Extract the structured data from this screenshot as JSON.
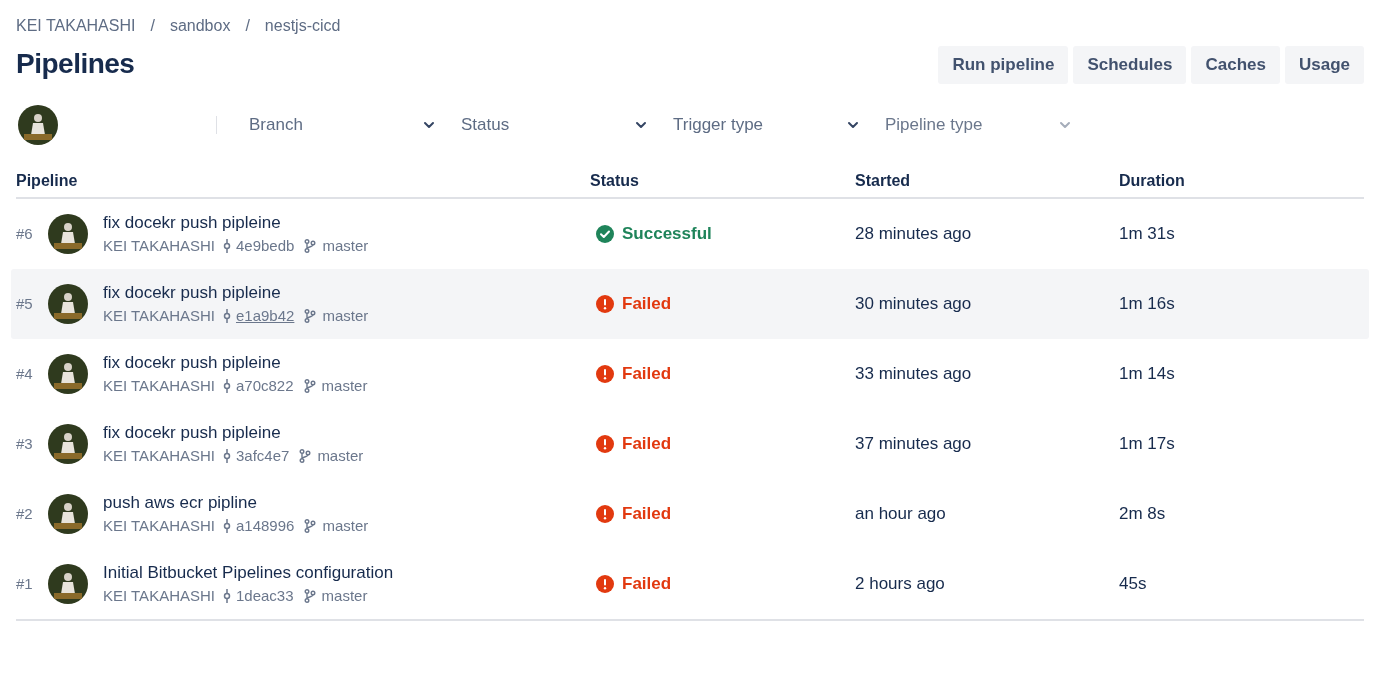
{
  "breadcrumbs": [
    "KEI TAKAHASHI",
    "sandbox",
    "nestjs-cicd"
  ],
  "breadcrumb_separators": [
    "/",
    "/"
  ],
  "title": "Pipelines",
  "actions": [
    "Run pipeline",
    "Schedules",
    "Caches",
    "Usage"
  ],
  "filters": [
    {
      "label": "Branch",
      "disabled": false
    },
    {
      "label": "Status",
      "disabled": false
    },
    {
      "label": "Trigger type",
      "disabled": false
    },
    {
      "label": "Pipeline type",
      "disabled": true
    }
  ],
  "table": {
    "columns": [
      "Pipeline",
      "Status",
      "Started",
      "Duration"
    ],
    "rows": [
      {
        "number": "#6",
        "message": "fix docekr push pipleine",
        "author": "KEI TAKAHASHI",
        "commit": "4e9bedb",
        "branch": "master",
        "status": "Successful",
        "kind": "success",
        "started": "28 minutes ago",
        "duration": "1m 31s",
        "hovered": false
      },
      {
        "number": "#5",
        "message": "fix docekr push pipleine",
        "author": "KEI TAKAHASHI",
        "commit": "e1a9b42",
        "branch": "master",
        "status": "Failed",
        "kind": "failed",
        "started": "30 minutes ago",
        "duration": "1m 16s",
        "hovered": true
      },
      {
        "number": "#4",
        "message": "fix docekr push pipleine",
        "author": "KEI TAKAHASHI",
        "commit": "a70c822",
        "branch": "master",
        "status": "Failed",
        "kind": "failed",
        "started": "33 minutes ago",
        "duration": "1m 14s",
        "hovered": false
      },
      {
        "number": "#3",
        "message": "fix docekr push pipleine",
        "author": "KEI TAKAHASHI",
        "commit": "3afc4e7",
        "branch": "master",
        "status": "Failed",
        "kind": "failed",
        "started": "37 minutes ago",
        "duration": "1m 17s",
        "hovered": false
      },
      {
        "number": "#2",
        "message": "push aws ecr pipline",
        "author": "KEI TAKAHASHI",
        "commit": "a148996",
        "branch": "master",
        "status": "Failed",
        "kind": "failed",
        "started": "an hour ago",
        "duration": "2m 8s",
        "hovered": false
      },
      {
        "number": "#1",
        "message": "Initial Bitbucket Pipelines configuration",
        "author": "KEI TAKAHASHI",
        "commit": "1deac33",
        "branch": "master",
        "status": "Failed",
        "kind": "failed",
        "started": "2 hours ago",
        "duration": "45s",
        "hovered": false
      }
    ]
  }
}
